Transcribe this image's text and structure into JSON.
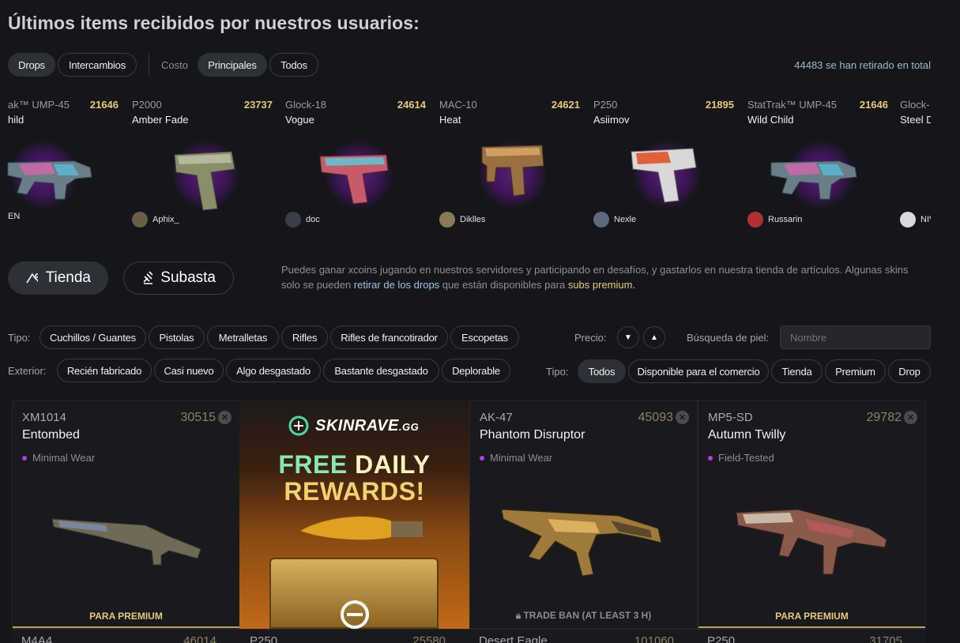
{
  "page_title": "Últimos items recibidos por nuestros usuarios:",
  "filters": {
    "drops": "Drops",
    "intercambios": "Intercambios",
    "costo_label": "Costo",
    "principales": "Principales",
    "todos": "Todos",
    "total_count": "44483",
    "total_text": " se han retirado en total"
  },
  "feed": [
    {
      "weapon": "ak™ UMP-45",
      "skin": "hild",
      "price": "21646",
      "user": "EN"
    },
    {
      "weapon": "P2000",
      "skin": "Amber Fade",
      "price": "23737",
      "user": "Aphix_"
    },
    {
      "weapon": "Glock-18",
      "skin": "Vogue",
      "price": "24614",
      "user": "doc"
    },
    {
      "weapon": "MAC-10",
      "skin": "Heat",
      "price": "24621",
      "user": "Diklles"
    },
    {
      "weapon": "P250",
      "skin": "Asiimov",
      "price": "21895",
      "user": "Nexle"
    },
    {
      "weapon": "StatTrak™ UMP-45",
      "skin": "Wild Child",
      "price": "21646",
      "user": "Russarin"
    },
    {
      "weapon": "Glock-",
      "skin": "Steel D",
      "price": "",
      "user": "NIV"
    }
  ],
  "shop": {
    "tienda": "Tienda",
    "subasta": "Subasta",
    "info_1": "Puedes ganar xcoins jugando en nuestros servidores y participando en desafíos, y gastarlos en nuestra tienda de artículos. Algunas skins solo se pueden ",
    "info_link": "retirar de los drops",
    "info_2": " que están disponibles para ",
    "info_premium": "subs premium."
  },
  "type_filter": {
    "label": "Tipo:",
    "options": [
      "Cuchillos / Guantes",
      "Pistolas",
      "Metralletas",
      "Rifles",
      "Rifles de francotirador",
      "Escopetas"
    ]
  },
  "exterior_filter": {
    "label": "Exterior:",
    "options": [
      "Recién fabricado",
      "Casi nuevo",
      "Algo desgastado",
      "Bastante desgastado",
      "Deplorable"
    ]
  },
  "price_label": "Precio:",
  "search": {
    "label": "Búsqueda de piel:",
    "placeholder": "Nombre"
  },
  "avail_filter": {
    "label": "Tipo:",
    "options": [
      "Todos",
      "Disponible para el comercio",
      "Tienda",
      "Premium",
      "Drop"
    ]
  },
  "cards": [
    {
      "weapon": "XM1014",
      "skin": "Entombed",
      "price": "30515",
      "wear": "Minimal Wear",
      "footer": "PARA PREMIUM"
    },
    {
      "weapon": "AK-47",
      "skin": "Phantom Disruptor",
      "price": "45093",
      "wear": "Minimal Wear",
      "footer": "TRADE BAN (AT LEAST 3 H)"
    },
    {
      "weapon": "MP5-SD",
      "skin": "Autumn Twilly",
      "price": "29782",
      "wear": "Field-Tested",
      "footer": "PARA PREMIUM"
    }
  ],
  "banner": {
    "brand": "SKINRAVE",
    "brand_suffix": ".GG",
    "line1a": "FREE ",
    "line1b": "DAILY",
    "line2": "REWARDS!"
  },
  "row2": [
    {
      "weapon": "M4A4",
      "price": "46014"
    },
    {
      "weapon": "P250",
      "price": "25580"
    },
    {
      "weapon": "Desert Eagle",
      "price": "101060"
    },
    {
      "weapon": "P250",
      "price": "31705"
    }
  ],
  "colors": {
    "accent_gold": "#e9c979",
    "accent_blue": "#9ec3e6",
    "wear_dot": "#b23fe3"
  }
}
